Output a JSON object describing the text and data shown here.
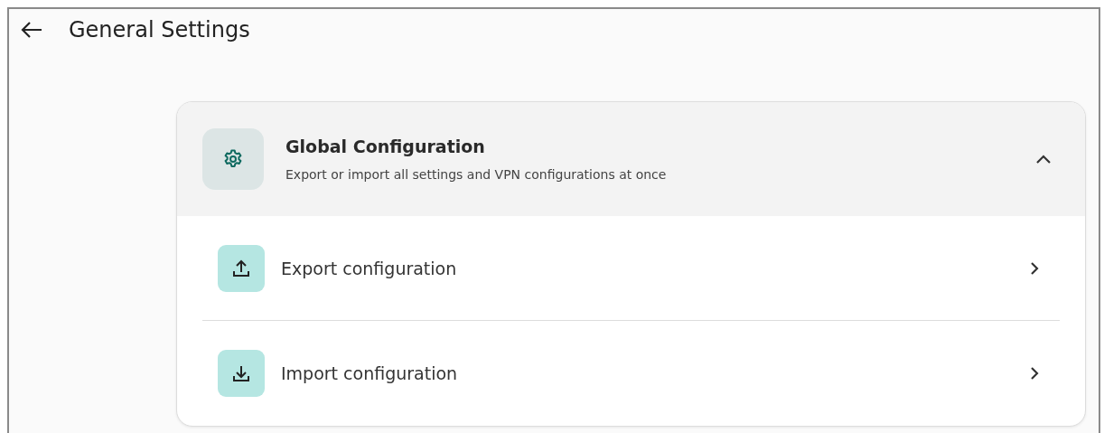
{
  "header": {
    "title": "General Settings"
  },
  "section": {
    "title": "Global Configuration",
    "subtitle": "Export or import all settings and VPN configurations at once",
    "expanded": true,
    "items": [
      {
        "kind": "export",
        "label": "Export configuration"
      },
      {
        "kind": "import",
        "label": "Import configuration"
      }
    ]
  }
}
